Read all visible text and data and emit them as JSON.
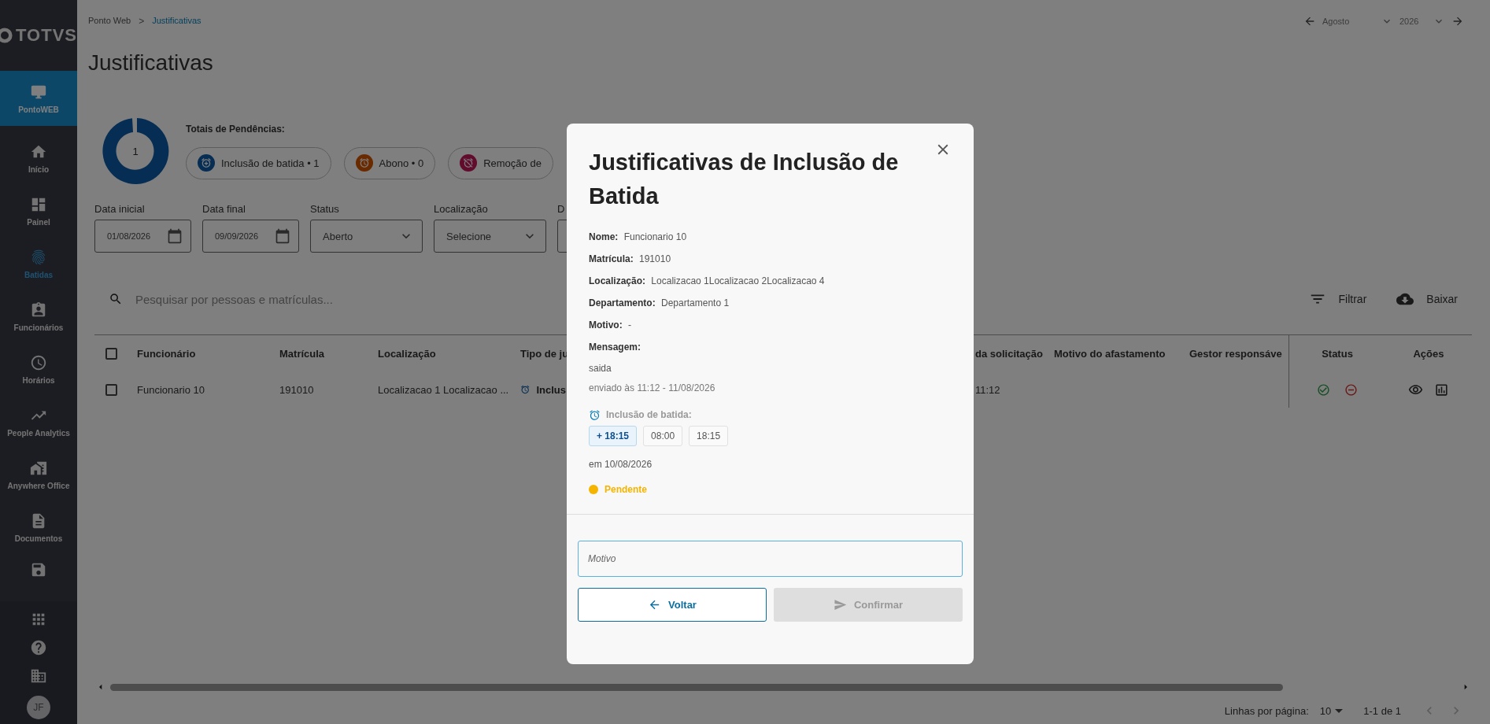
{
  "sidebar": {
    "logo": "TOTVS",
    "module": {
      "label": "PontoWEB",
      "selected": true
    },
    "items": [
      {
        "label": "Início",
        "selected": false
      },
      {
        "label": "Painel",
        "selected": false
      },
      {
        "label": "Batidas",
        "selected": true
      },
      {
        "label": "Funcionários",
        "selected": false
      },
      {
        "label": "Horários",
        "selected": false
      },
      {
        "label": "People Analytics",
        "selected": false
      },
      {
        "label": "Anywhere Office",
        "selected": false
      },
      {
        "label": "Documentos",
        "selected": false
      }
    ],
    "avatar": "JF"
  },
  "breadcrumb": [
    {
      "label": "Ponto Web",
      "selected": false
    },
    {
      "label": ">",
      "kind": "separator"
    },
    {
      "label": "Justificativas",
      "selected": true
    }
  ],
  "period": {
    "month": "Agosto",
    "year": "2026"
  },
  "title": "Justificativas",
  "totals": {
    "donut_value": "1",
    "label": "Totais de Pendências:",
    "chips": [
      {
        "label": "Inclusão de batida",
        "count": "• 1",
        "kind": "inclusion"
      },
      {
        "label": "Abono",
        "count": "• 0",
        "kind": "abono"
      },
      {
        "label": "Remoção de",
        "kind": "removal"
      }
    ]
  },
  "filters": [
    {
      "label": "Data inicial",
      "value": "01/08/2026",
      "kind": "date"
    },
    {
      "label": "Data final",
      "value": "09/09/2026",
      "kind": "date"
    },
    {
      "label": "Status",
      "value": "Aberto",
      "kind": "select"
    },
    {
      "label": "Localização",
      "value": "Selecione",
      "kind": "select"
    },
    {
      "label": "D",
      "kind": "partial"
    }
  ],
  "search": {
    "placeholder": "Pesquisar por pessoas e matrículas..."
  },
  "toolbar": [
    {
      "label": "Filtrar",
      "kind": "filter"
    },
    {
      "label": "Baixar",
      "kind": "download"
    }
  ],
  "table": {
    "select_all": {
      "checked": false
    },
    "columns": [
      "Funcionário",
      "Matrícula",
      "Localização",
      "Tipo de ju",
      "da solicitação",
      "Motivo do afastamento",
      "Gestor responsáve",
      "Status",
      "Ações"
    ],
    "rows": [
      {
        "checked": false,
        "funcionario": "Funcionario 10",
        "matricula": "191010",
        "localizacao": "Localizacao 1 Localizacao ...",
        "tipo": "Inclus",
        "data": "11:12"
      }
    ]
  },
  "pagination": {
    "label": "Linhas por página:",
    "per_page": "10",
    "range": "1-1 de 1"
  },
  "modal": {
    "title": "Justificativas de Inclusão de Batida",
    "fields": [
      "**Nome:** Funcionario 10",
      "**Matrícula:** 191010",
      "**Localização:** Localizacao 1Localizacao 2Localizacao 4",
      "**Departamento:** Departamento 1",
      "**Motivo:** -"
    ],
    "message_label": "Mensagem:",
    "message": "saida",
    "sent": "enviado às 11:12 - 11/08/2026",
    "punch_label": "Inclusão de batida:",
    "punches": [
      {
        "label": "+ 18:15",
        "kind": "added"
      },
      {
        "label": "08:00",
        "kind": "existing"
      },
      {
        "label": "18:15",
        "kind": "existing"
      }
    ],
    "date": "em 10/08/2026",
    "status": {
      "label": "Pendente",
      "color": "#f5b400"
    },
    "reason": {
      "placeholder": "Motivo"
    },
    "buttons": [
      {
        "label": "Voltar",
        "kind": "back",
        "disabled": false
      },
      {
        "label": "Confirmar",
        "kind": "confirm",
        "disabled": true
      }
    ]
  }
}
